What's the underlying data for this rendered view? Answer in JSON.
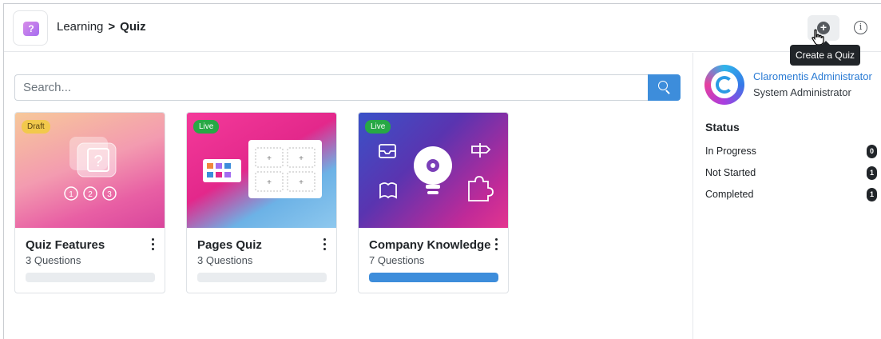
{
  "header": {
    "breadcrumb": [
      "Learning",
      "Quiz"
    ],
    "separator": ">",
    "create_tooltip": "Create a Quiz"
  },
  "search": {
    "placeholder": "Search..."
  },
  "quizzes": [
    {
      "status": "Draft",
      "title": "Quiz Features",
      "subtitle": "3 Questions",
      "progress": 0
    },
    {
      "status": "Live",
      "title": "Pages Quiz",
      "subtitle": "3 Questions",
      "progress": 0
    },
    {
      "status": "Live",
      "title": "Company Knowledge",
      "subtitle": "7 Questions",
      "progress": 1.0
    }
  ],
  "user": {
    "name": "Claromentis Administrator",
    "role": "System Administrator"
  },
  "status": {
    "title": "Status",
    "rows": [
      {
        "label": "In Progress",
        "count": "0"
      },
      {
        "label": "Not Started",
        "count": "1"
      },
      {
        "label": "Completed",
        "count": "1"
      }
    ]
  },
  "colors": {
    "accent": "#3d8ddb",
    "draft": "#f2c94c",
    "live": "#27a845"
  },
  "icons": [
    "question-icon",
    "plus-circle-icon",
    "info-icon",
    "search-icon",
    "kebab-icon",
    "pointer-cursor-icon"
  ]
}
